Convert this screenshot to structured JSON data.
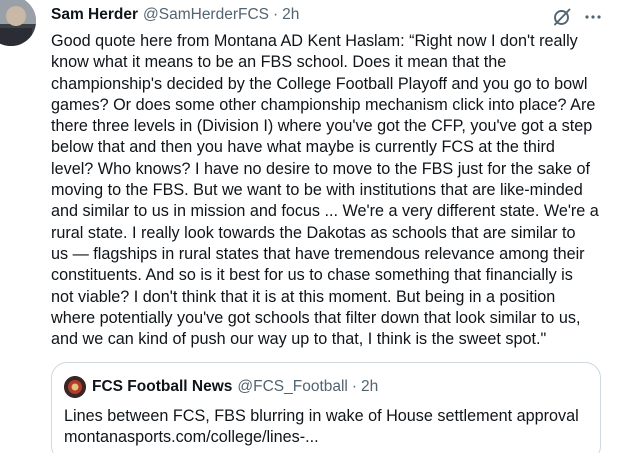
{
  "tweet": {
    "display_name": "Sam Herder",
    "handle": "@SamHerderFCS",
    "separator": "·",
    "time": "2h",
    "text": "Good quote here from Montana AD Kent Haslam: “Right now I don't really\nknow what it means to be an FBS school. Does it mean that the\nchampionship's decided by the College Football Playoff and you go to bowl\ngames? Or does some other championship mechanism click into place? Are\nthere three levels in (Division I) where you've got the CFP, you've got a step\nbelow that and then you have what maybe is currently FCS at the third\nlevel? Who knows? I have no desire to move to the FBS just for the sake of\nmoving to the FBS. But we want to be with institutions that are like-minded\nand similar to us in mission and focus ... We're a very different state. We're a\nrural state. I really look towards the Dakotas as schools that are similar to\nus — flagships in rural states that have tremendous relevance among their\nconstituents. And so is it best for us to chase something that financially is\nnot viable? I don't think that it is at this moment. But being in a position\nwhere potentially you've got schools that filter down that look similar to us,\nand we can kind of push our way up to that, I think is the sweet spot.\"",
    "icons": {
      "grok": "grok-icon",
      "more": "more-icon"
    }
  },
  "quote": {
    "display_name": "FCS Football News",
    "handle": "@FCS_Football",
    "separator": "·",
    "time": "2h",
    "title": "Lines between FCS, FBS blurring in wake of House settlement approval",
    "link": "montanasports.com/college/lines-..."
  },
  "colors": {
    "text": "#0f1419",
    "secondary": "#536471",
    "border": "#cfd9de"
  }
}
